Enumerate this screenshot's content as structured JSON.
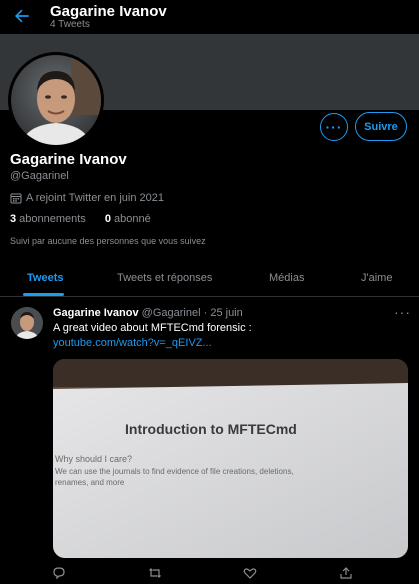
{
  "header": {
    "name": "Gagarine Ivanov",
    "tweet_count": "4 Tweets"
  },
  "profile": {
    "name": "Gagarine Ivanov",
    "handle": "@Gagarinel",
    "joined": "A rejoint Twitter en juin 2021",
    "following_count": "3",
    "following_label": "abonnements",
    "followers_count": "0",
    "followers_label": "abonné",
    "followed_by": "Suivi par aucune des personnes que vous suivez",
    "follow_label": "Suivre"
  },
  "tabs": [
    {
      "label": "Tweets",
      "active": true
    },
    {
      "label": "Tweets et réponses",
      "active": false
    },
    {
      "label": "Médias",
      "active": false
    },
    {
      "label": "J'aime",
      "active": false
    }
  ],
  "tweet": {
    "author": "Gagarine Ivanov",
    "handle": "@Gagarinel",
    "separator": "·",
    "date": "25 juin",
    "text": "A great video about MFTECmd forensic :",
    "link": "youtube.com/watch?v=_qEIVZ...",
    "media": {
      "title": "Introduction to MFTECmd",
      "question": "Why should I care?",
      "bullet_line1": "We can use the journals to find evidence of file creations, deletions,",
      "bullet_line2": "renames, and more"
    }
  },
  "colors": {
    "accent": "#1d9bf0",
    "background": "#000000",
    "banner": "#333639"
  }
}
